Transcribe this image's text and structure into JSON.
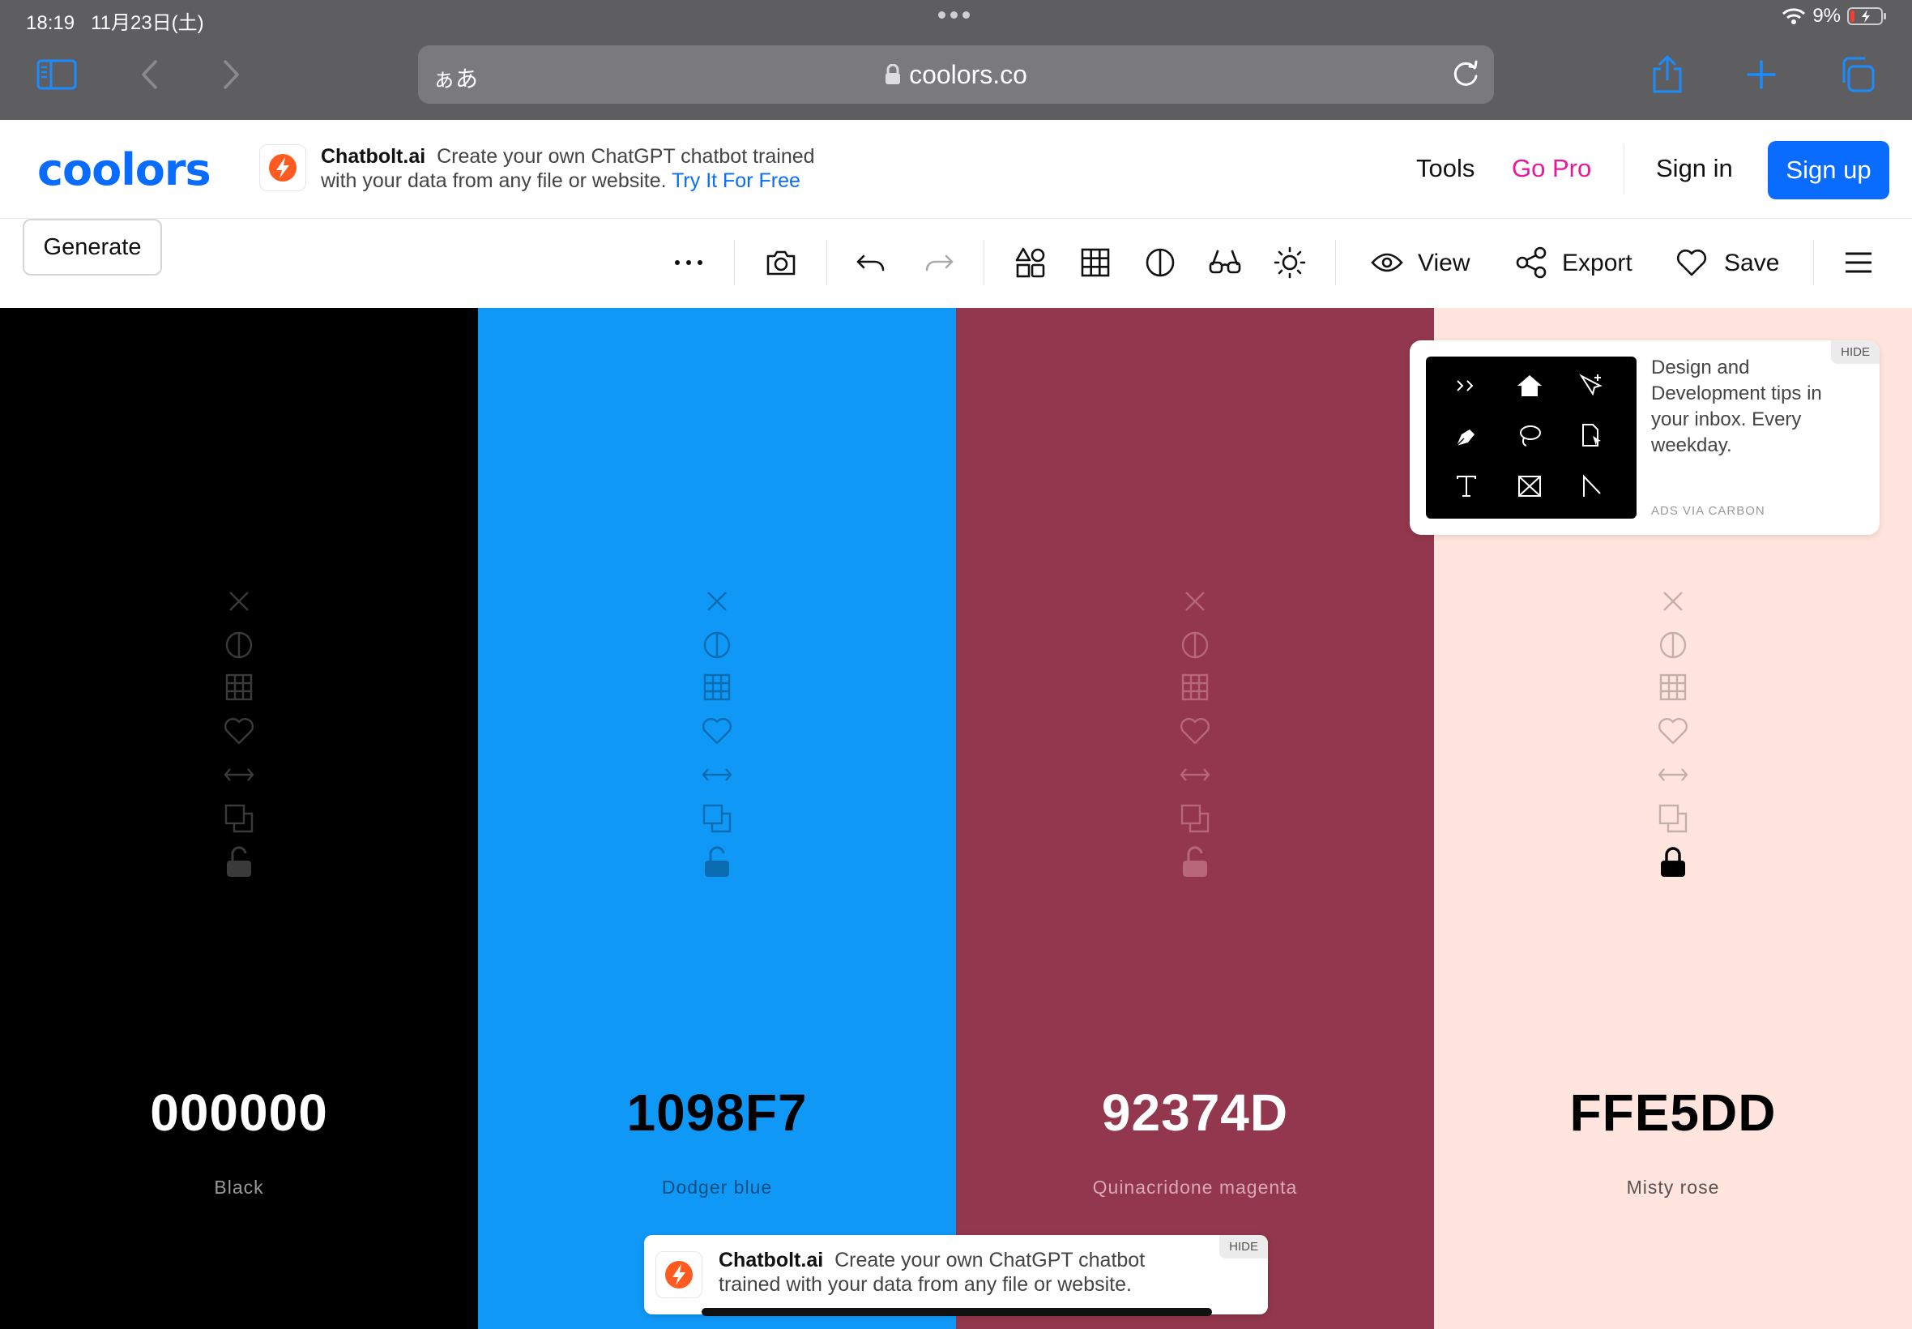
{
  "status_bar": {
    "time": "18:19",
    "date": "11月23日(土)",
    "battery": "9%"
  },
  "browser": {
    "aa_label": "ぁあ",
    "host": "coolors.co"
  },
  "header": {
    "logo": "coolors",
    "ad": {
      "brand": "Chatbolt.ai",
      "text": "Create your own ChatGPT chatbot trained with your data from any file or website.",
      "cta": "Try It For Free"
    },
    "nav": {
      "tools": "Tools",
      "go_pro": "Go Pro",
      "sign_in": "Sign in",
      "sign_up": "Sign up"
    }
  },
  "toolbar": {
    "generate": "Generate",
    "view": "View",
    "export": "Export",
    "save": "Save"
  },
  "palette": [
    {
      "hex": "000000",
      "name": "Black",
      "color": "#000000",
      "text_color": "#ffffff",
      "name_color": "#9a9a9a",
      "icon_color": "#3a3a3a",
      "locked": false
    },
    {
      "hex": "1098F7",
      "name": "Dodger blue",
      "color": "#1098F7",
      "text_color": "#000000",
      "name_color": "#0b4f80",
      "icon_color": "#0b6cb2",
      "locked": false
    },
    {
      "hex": "92374D",
      "name": "Quinacridone magenta",
      "color": "#92374D",
      "text_color": "#ffffff",
      "name_color": "#d9a8b4",
      "icon_color": "#b8677a",
      "locked": false
    },
    {
      "hex": "FFE5DD",
      "name": "Misty rose",
      "color": "#FFE5DD",
      "text_color": "#000000",
      "name_color": "#5a5050",
      "icon_color": "#c4b0aa",
      "locked": true
    }
  ],
  "carbon_ad": {
    "text": "Design and Development tips in your inbox. Every weekday.",
    "via": "ADS VIA CARBON",
    "hide": "HIDE"
  },
  "bottom_ad": {
    "brand": "Chatbolt.ai",
    "text": "Create your own ChatGPT chatbot trained with your data from any file or website.",
    "hide": "HIDE"
  }
}
